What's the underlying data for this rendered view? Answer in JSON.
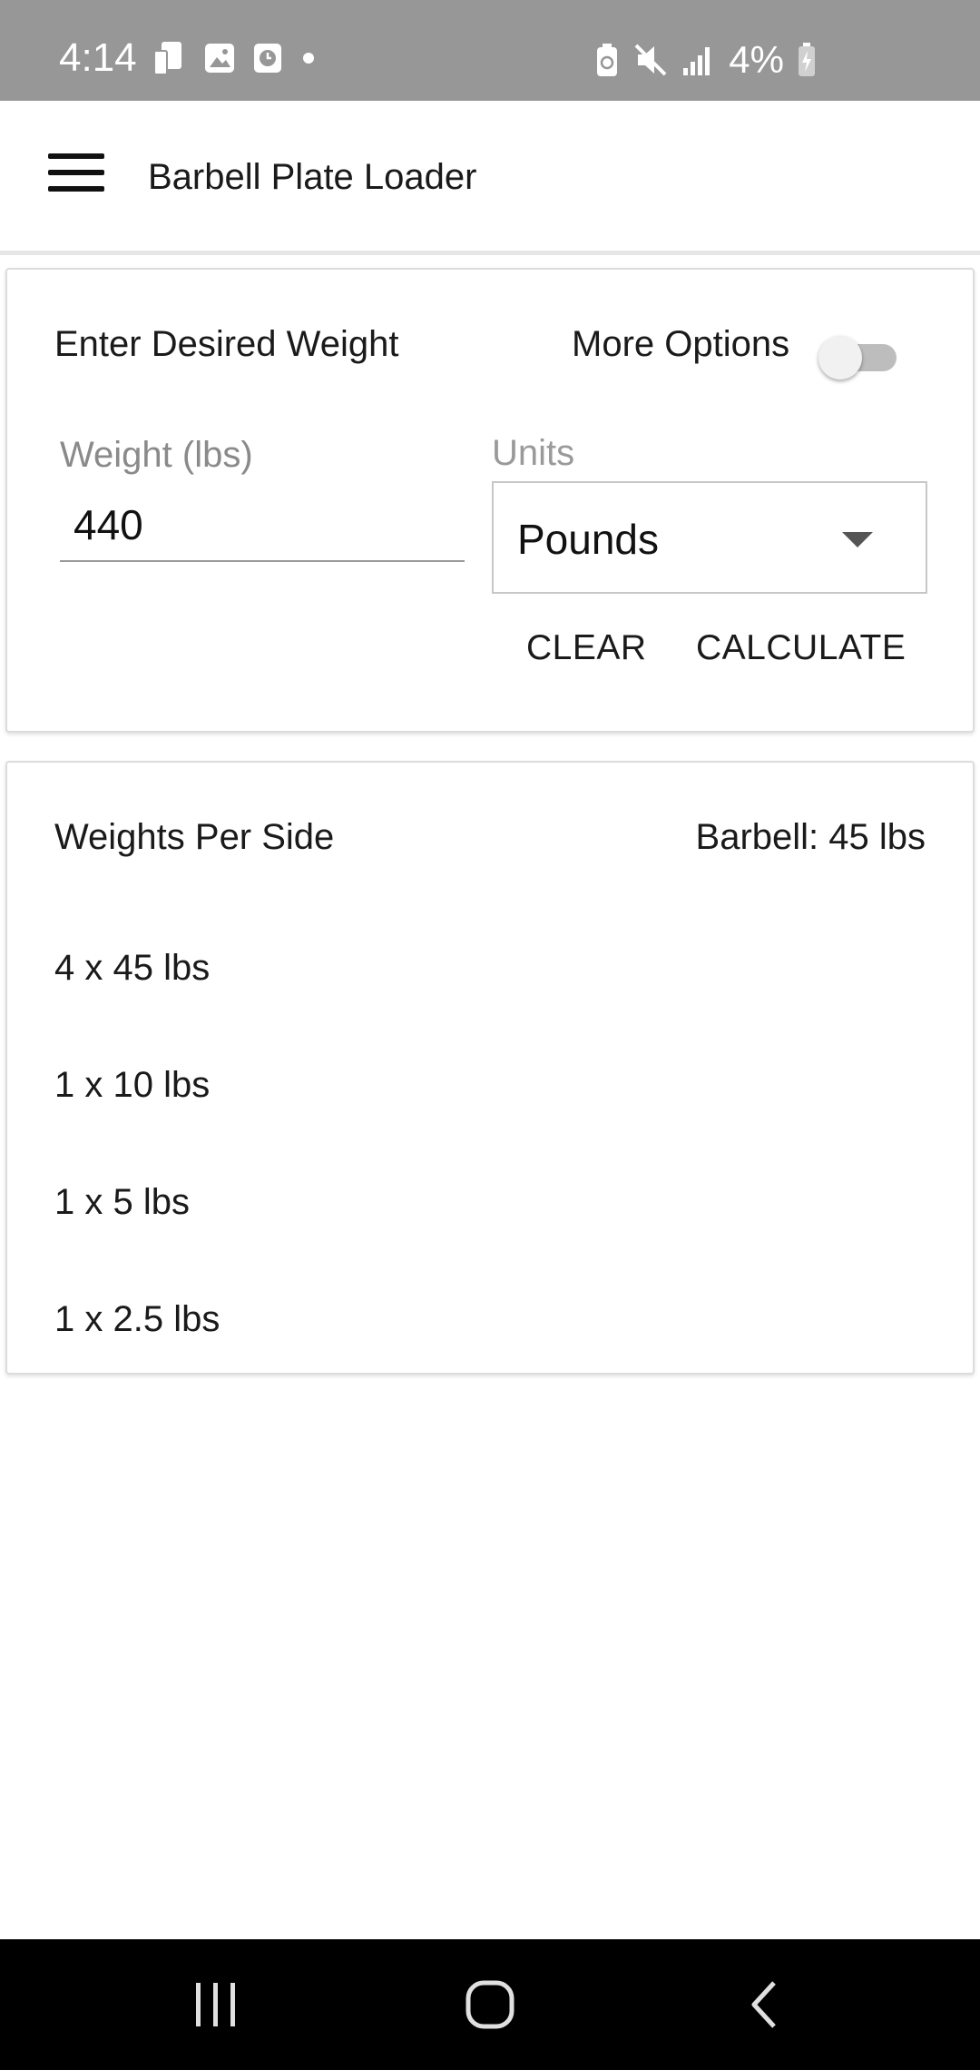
{
  "status_bar": {
    "time": "4:14",
    "battery_text": "4%",
    "left_icons": [
      "phone-transfer-icon",
      "gallery-icon",
      "clock-icon",
      "dot-icon"
    ],
    "right_icons": [
      "battery-saver-icon",
      "mute-icon",
      "signal-icon",
      "battery-charging-icon"
    ]
  },
  "app_bar": {
    "title": "Barbell Plate Loader",
    "menu_icon": "hamburger-menu-icon"
  },
  "input_card": {
    "heading": "Enter Desired Weight",
    "more_options_label": "More Options",
    "more_options_enabled": false,
    "weight_label": "Weight (lbs)",
    "weight_value": "440",
    "units_label": "Units",
    "units_selected": "Pounds",
    "clear_label": "CLEAR",
    "calculate_label": "CALCULATE"
  },
  "result_card": {
    "heading": "Weights Per Side",
    "barbell_info": "Barbell: 45 lbs",
    "plates": [
      "4 x 45 lbs",
      "1 x 10 lbs",
      "1 x 5 lbs",
      "1 x 2.5 lbs"
    ]
  },
  "nav_bar": {
    "buttons": [
      "recents-icon",
      "home-icon",
      "back-icon"
    ]
  }
}
